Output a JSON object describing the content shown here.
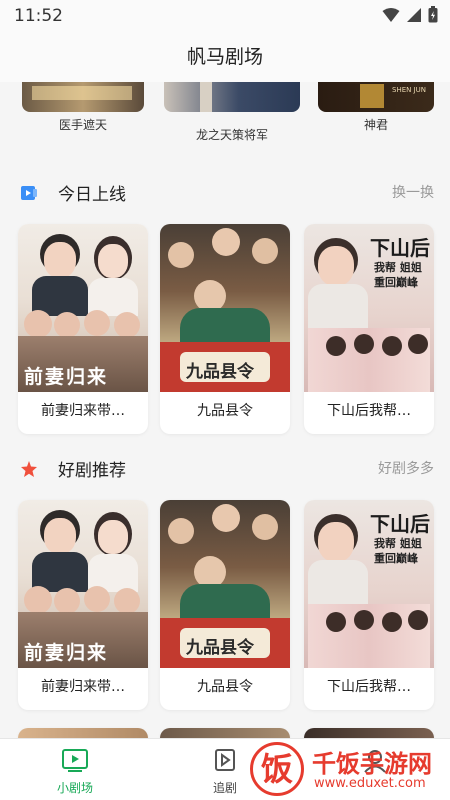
{
  "status": {
    "time": "11:52"
  },
  "header": {
    "title": "帆马剧场"
  },
  "prev_row": [
    {
      "title": "医手遮天",
      "poster_text": ""
    },
    {
      "title": "龙之天策将军",
      "poster_text": ""
    },
    {
      "title": "神君",
      "poster_text": "SHEN JUN"
    }
  ],
  "sections": [
    {
      "title": "今日上线",
      "more": "换一换",
      "cards": [
        {
          "title": "前妻归来带…",
          "poster_text": "前妻归来"
        },
        {
          "title": "九品县令",
          "poster_text": "九品县令"
        },
        {
          "title": "下山后我帮…",
          "poster_text": "下山后",
          "poster_sub": "我帮 姐姐 重回巅峰"
        }
      ]
    },
    {
      "title": "好剧推荐",
      "more": "好剧多多",
      "cards": [
        {
          "title": "前妻归来带…",
          "poster_text": "前妻归来"
        },
        {
          "title": "九品县令",
          "poster_text": "九品县令"
        },
        {
          "title": "下山后我帮…",
          "poster_text": "下山后",
          "poster_sub": "我帮 姐姐 重回巅峰"
        }
      ]
    }
  ],
  "tabs": [
    {
      "label": "小剧场",
      "active": true
    },
    {
      "label": "追剧",
      "active": false
    },
    {
      "label": "",
      "active": false
    }
  ],
  "watermark": {
    "brand": "千饭手游网",
    "url": "www.eduxet.com",
    "glyph": "饭"
  },
  "colors": {
    "accent": "#18a957",
    "section_icon_blue": "#3a8ef6",
    "section_icon_red": "#f0503c",
    "watermark_red": "#e63b2e"
  }
}
